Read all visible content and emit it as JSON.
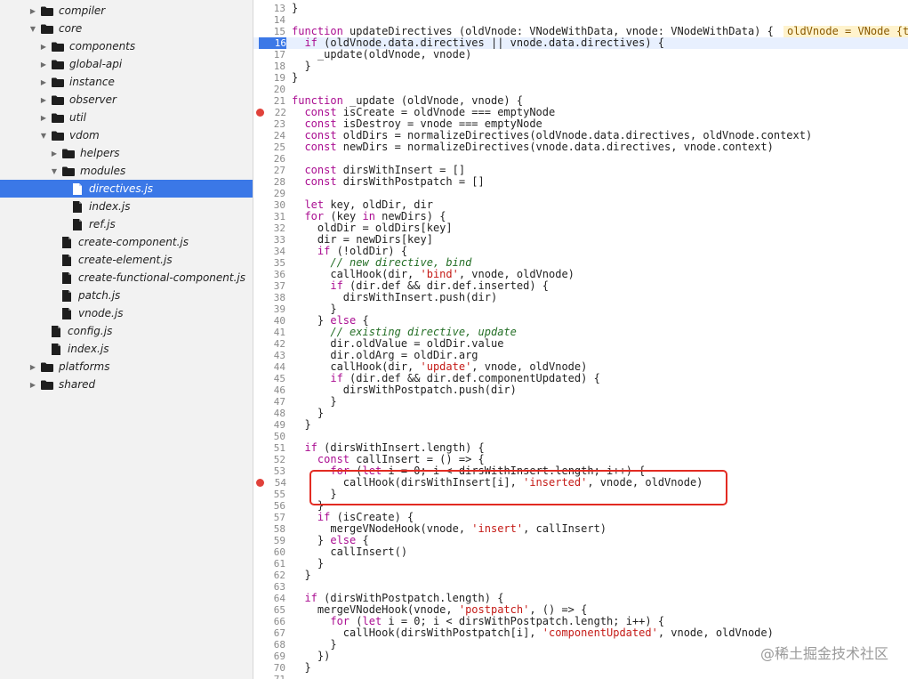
{
  "sidebar": {
    "items": [
      {
        "label": "compiler",
        "kind": "folder",
        "depth": 0,
        "expanded": false
      },
      {
        "label": "core",
        "kind": "folder",
        "depth": 0,
        "expanded": true
      },
      {
        "label": "components",
        "kind": "folder",
        "depth": 1,
        "expanded": false
      },
      {
        "label": "global-api",
        "kind": "folder",
        "depth": 1,
        "expanded": false
      },
      {
        "label": "instance",
        "kind": "folder",
        "depth": 1,
        "expanded": false
      },
      {
        "label": "observer",
        "kind": "folder",
        "depth": 1,
        "expanded": false
      },
      {
        "label": "util",
        "kind": "folder",
        "depth": 1,
        "expanded": false
      },
      {
        "label": "vdom",
        "kind": "folder",
        "depth": 1,
        "expanded": true
      },
      {
        "label": "helpers",
        "kind": "folder",
        "depth": 2,
        "expanded": false
      },
      {
        "label": "modules",
        "kind": "folder",
        "depth": 2,
        "expanded": true
      },
      {
        "label": "directives.js",
        "kind": "file",
        "depth": 3,
        "selected": true
      },
      {
        "label": "index.js",
        "kind": "file",
        "depth": 3
      },
      {
        "label": "ref.js",
        "kind": "file",
        "depth": 3
      },
      {
        "label": "create-component.js",
        "kind": "file",
        "depth": 2
      },
      {
        "label": "create-element.js",
        "kind": "file",
        "depth": 2
      },
      {
        "label": "create-functional-component.js",
        "kind": "file",
        "depth": 2
      },
      {
        "label": "patch.js",
        "kind": "file",
        "depth": 2
      },
      {
        "label": "vnode.js",
        "kind": "file",
        "depth": 2
      },
      {
        "label": "config.js",
        "kind": "file",
        "depth": 1
      },
      {
        "label": "index.js",
        "kind": "file",
        "depth": 1
      },
      {
        "label": "platforms",
        "kind": "folder",
        "depth": 0,
        "expanded": false
      },
      {
        "label": "shared",
        "kind": "folder",
        "depth": 0,
        "expanded": false
      }
    ]
  },
  "editor": {
    "inline_value": "oldVnode = VNode {t",
    "lines": [
      {
        "n": "13",
        "text": "}"
      },
      {
        "n": "14",
        "text": ""
      },
      {
        "n": "15",
        "text": "function updateDirectives (oldVnode: VNodeWithData, vnode: VNodeWithData) {"
      },
      {
        "n": "16",
        "text": "  if (oldVnode.data.directives || vnode.data.directives) {",
        "breakpoint": "active"
      },
      {
        "n": "17",
        "text": "    _update(oldVnode, vnode)"
      },
      {
        "n": "18",
        "text": "  }"
      },
      {
        "n": "19",
        "text": "}"
      },
      {
        "n": "20",
        "text": ""
      },
      {
        "n": "21",
        "text": "function _update (oldVnode, vnode) {"
      },
      {
        "n": "22",
        "text": "  const isCreate = oldVnode === emptyNode",
        "breakpoint": "red"
      },
      {
        "n": "23",
        "text": "  const isDestroy = vnode === emptyNode"
      },
      {
        "n": "24",
        "text": "  const oldDirs = normalizeDirectives(oldVnode.data.directives, oldVnode.context)"
      },
      {
        "n": "25",
        "text": "  const newDirs = normalizeDirectives(vnode.data.directives, vnode.context)"
      },
      {
        "n": "26",
        "text": ""
      },
      {
        "n": "27",
        "text": "  const dirsWithInsert = []"
      },
      {
        "n": "28",
        "text": "  const dirsWithPostpatch = []"
      },
      {
        "n": "29",
        "text": ""
      },
      {
        "n": "30",
        "text": "  let key, oldDir, dir"
      },
      {
        "n": "31",
        "text": "  for (key in newDirs) {"
      },
      {
        "n": "32",
        "text": "    oldDir = oldDirs[key]"
      },
      {
        "n": "33",
        "text": "    dir = newDirs[key]"
      },
      {
        "n": "34",
        "text": "    if (!oldDir) {"
      },
      {
        "n": "35",
        "text": "      // new directive, bind"
      },
      {
        "n": "36",
        "text": "      callHook(dir, 'bind', vnode, oldVnode)"
      },
      {
        "n": "37",
        "text": "      if (dir.def && dir.def.inserted) {"
      },
      {
        "n": "38",
        "text": "        dirsWithInsert.push(dir)"
      },
      {
        "n": "39",
        "text": "      }"
      },
      {
        "n": "40",
        "text": "    } else {"
      },
      {
        "n": "41",
        "text": "      // existing directive, update"
      },
      {
        "n": "42",
        "text": "      dir.oldValue = oldDir.value"
      },
      {
        "n": "43",
        "text": "      dir.oldArg = oldDir.arg"
      },
      {
        "n": "44",
        "text": "      callHook(dir, 'update', vnode, oldVnode)"
      },
      {
        "n": "45",
        "text": "      if (dir.def && dir.def.componentUpdated) {"
      },
      {
        "n": "46",
        "text": "        dirsWithPostpatch.push(dir)"
      },
      {
        "n": "47",
        "text": "      }"
      },
      {
        "n": "48",
        "text": "    }"
      },
      {
        "n": "49",
        "text": "  }"
      },
      {
        "n": "50",
        "text": ""
      },
      {
        "n": "51",
        "text": "  if (dirsWithInsert.length) {"
      },
      {
        "n": "52",
        "text": "    const callInsert = () => {"
      },
      {
        "n": "53",
        "text": "      for (let i = 0; i < dirsWithInsert.length; i++) {"
      },
      {
        "n": "54",
        "text": "        callHook(dirsWithInsert[i], 'inserted', vnode, oldVnode)",
        "breakpoint": "red"
      },
      {
        "n": "55",
        "text": "      }"
      },
      {
        "n": "56",
        "text": "    }"
      },
      {
        "n": "57",
        "text": "    if (isCreate) {"
      },
      {
        "n": "58",
        "text": "      mergeVNodeHook(vnode, 'insert', callInsert)"
      },
      {
        "n": "59",
        "text": "    } else {"
      },
      {
        "n": "60",
        "text": "      callInsert()"
      },
      {
        "n": "61",
        "text": "    }"
      },
      {
        "n": "62",
        "text": "  }"
      },
      {
        "n": "63",
        "text": ""
      },
      {
        "n": "64",
        "text": "  if (dirsWithPostpatch.length) {"
      },
      {
        "n": "65",
        "text": "    mergeVNodeHook(vnode, 'postpatch', () => {"
      },
      {
        "n": "66",
        "text": "      for (let i = 0; i < dirsWithPostpatch.length; i++) {"
      },
      {
        "n": "67",
        "text": "        callHook(dirsWithPostpatch[i], 'componentUpdated', vnode, oldVnode)"
      },
      {
        "n": "68",
        "text": "      }"
      },
      {
        "n": "69",
        "text": "    })"
      },
      {
        "n": "70",
        "text": "  }"
      },
      {
        "n": "71",
        "text": ""
      }
    ]
  },
  "watermark": "@稀土掘金技术社区",
  "colors": {
    "selection": "#3b78e7",
    "breakpoint": "#e0413a",
    "highlight_box": "#e22b22",
    "keyword": "#aa0d91",
    "string": "#c41a16",
    "comment": "#236e25"
  }
}
